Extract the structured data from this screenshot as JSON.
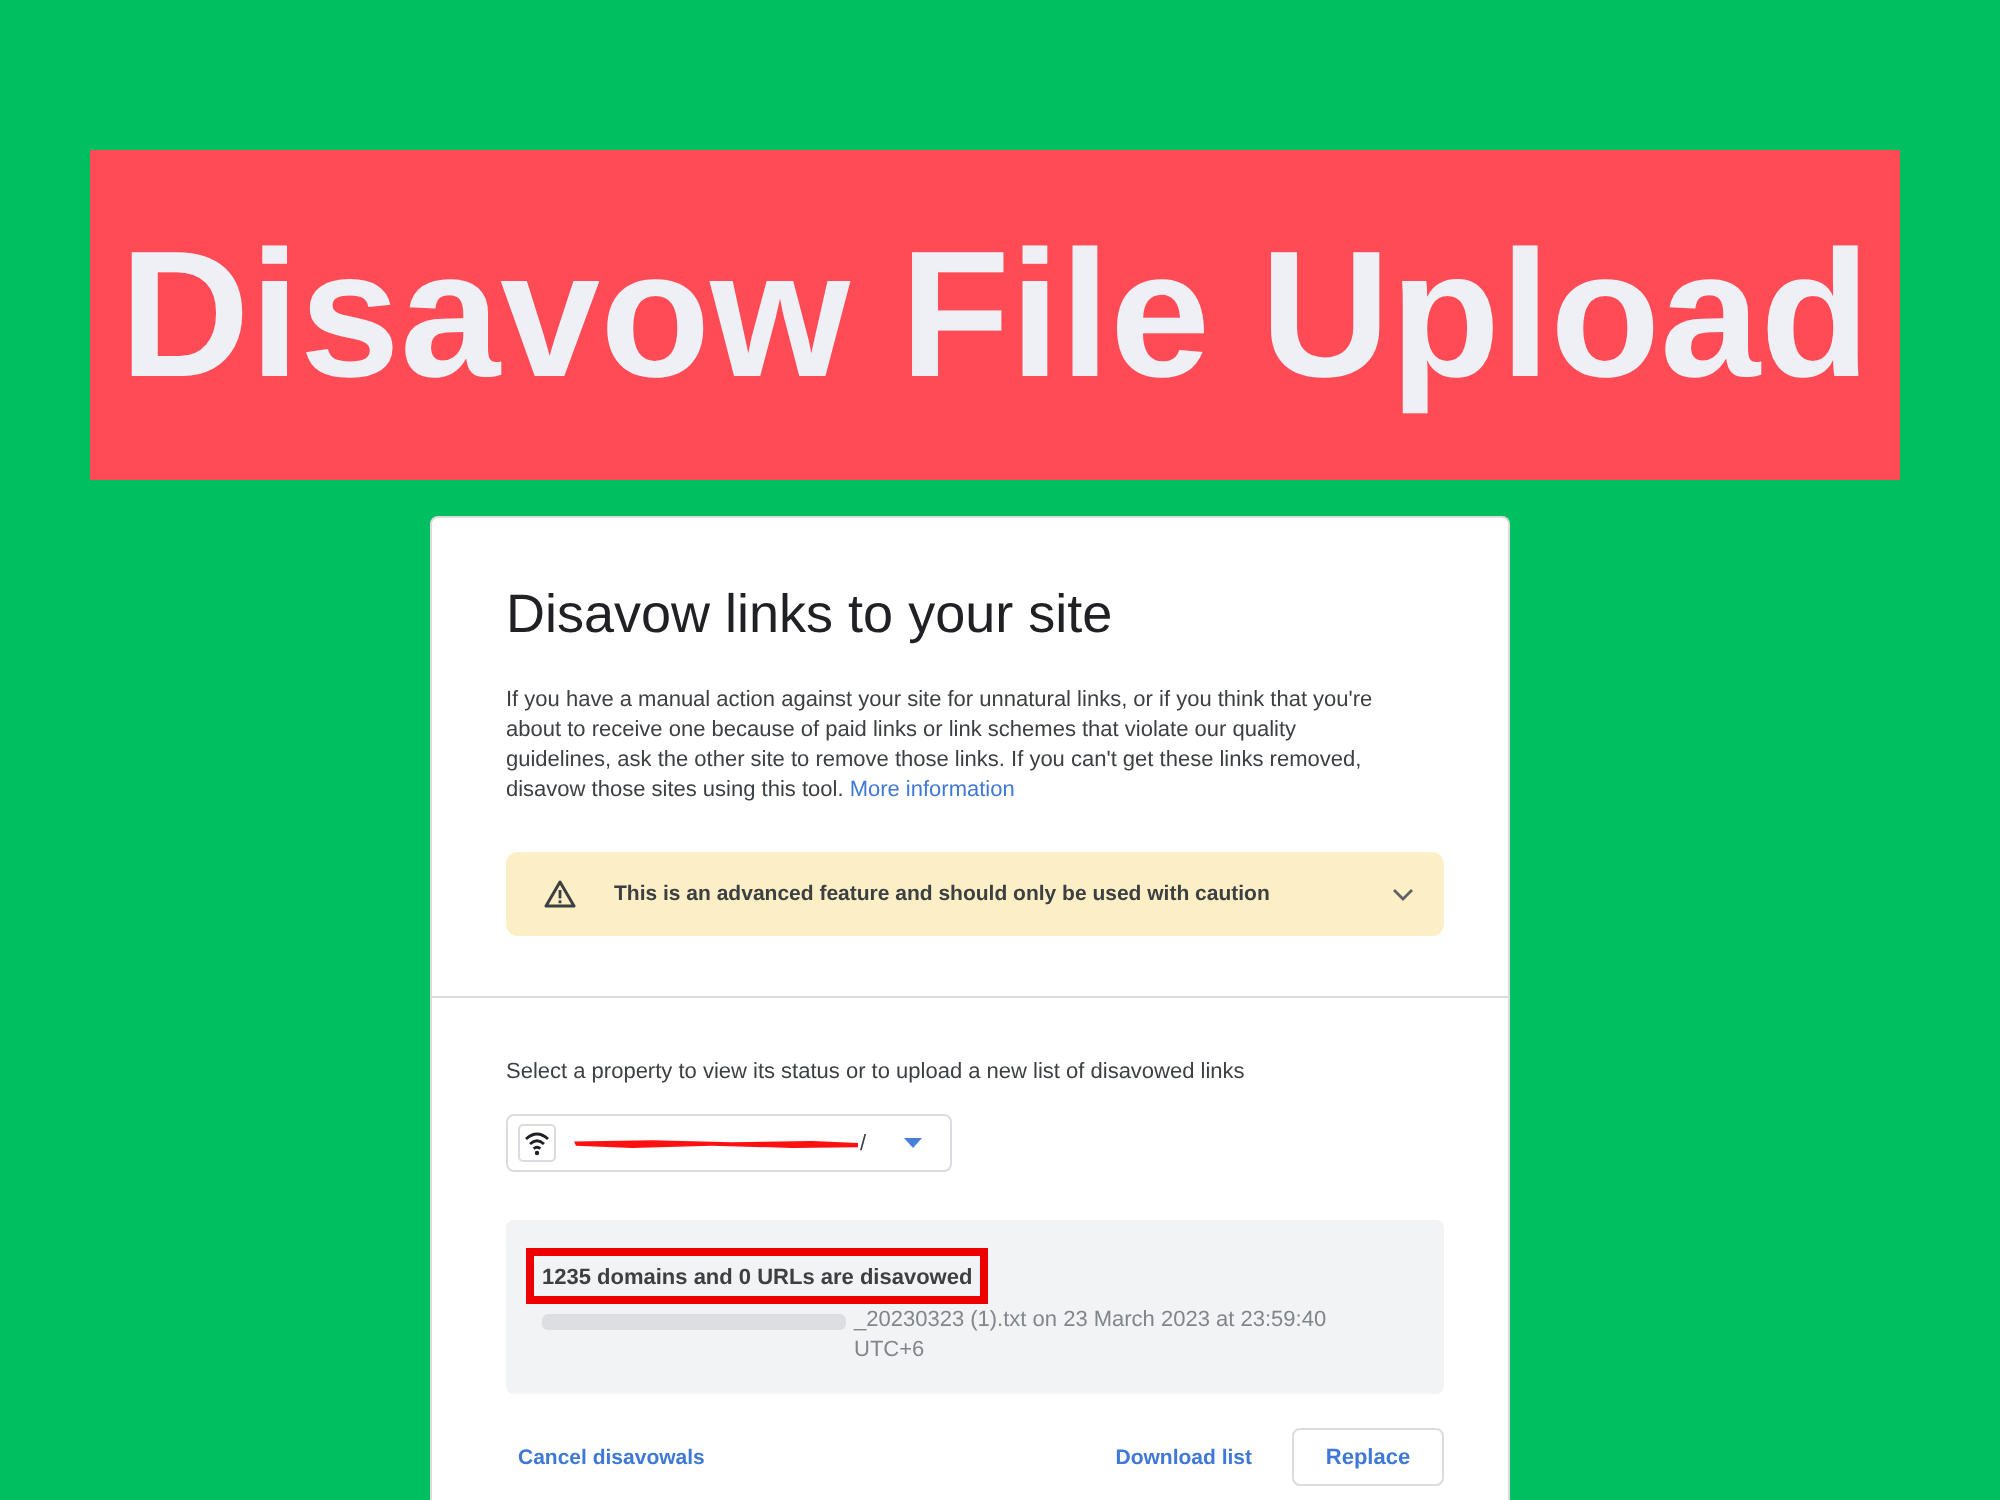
{
  "banner": {
    "title": "Disavow File Upload"
  },
  "card": {
    "title": "Disavow links to your site",
    "description": "If you have a manual action against your site for unnatural links, or if you think that you're about to receive one because of paid links or link schemes that violate our quality guidelines, ask the other site to remove those links. If you can't get these links removed, disavow those sites using this tool.",
    "more_link": "More information",
    "warning": {
      "text": "This is an advanced feature and should only be used with caution",
      "expanded": false
    },
    "property_prompt": "Select a property to view its status or to upload a new list of disavowed links",
    "property_selector": {
      "value": "/"
    },
    "status": {
      "summary": "1235 domains and 0 URLs are disavowed",
      "highlighted": true,
      "upload_info": "_20230323 (1).txt on 23 March 2023 at 23:59:40 UTC+6"
    },
    "actions": {
      "cancel_link": "Cancel disavowals",
      "download_link": "Download list",
      "replace_button": "Replace"
    }
  }
}
